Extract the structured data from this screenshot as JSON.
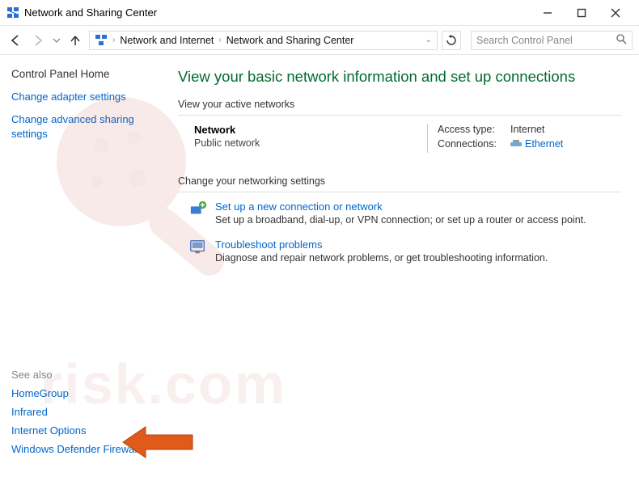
{
  "title": "Network and Sharing Center",
  "breadcrumb": {
    "part1": "Network and Internet",
    "part2": "Network and Sharing Center"
  },
  "search": {
    "placeholder": "Search Control Panel"
  },
  "sidebar": {
    "home": "Control Panel Home",
    "links": [
      "Change adapter settings",
      "Change advanced sharing settings"
    ]
  },
  "see_also": {
    "heading": "See also",
    "items": [
      "HomeGroup",
      "Infrared",
      "Internet Options",
      "Windows Defender Firewall"
    ]
  },
  "main": {
    "title": "View your basic network information and set up connections",
    "view_active": "View your active networks",
    "network": {
      "name": "Network",
      "type": "Public network",
      "access_label": "Access type:",
      "access_value": "Internet",
      "conn_label": "Connections:",
      "conn_value": "Ethernet"
    },
    "change_heading": "Change your networking settings",
    "setup": {
      "link": "Set up a new connection or network",
      "desc": "Set up a broadband, dial-up, or VPN connection; or set up a router or access point."
    },
    "troubleshoot": {
      "link": "Troubleshoot problems",
      "desc": "Diagnose and repair network problems, or get troubleshooting information."
    }
  }
}
